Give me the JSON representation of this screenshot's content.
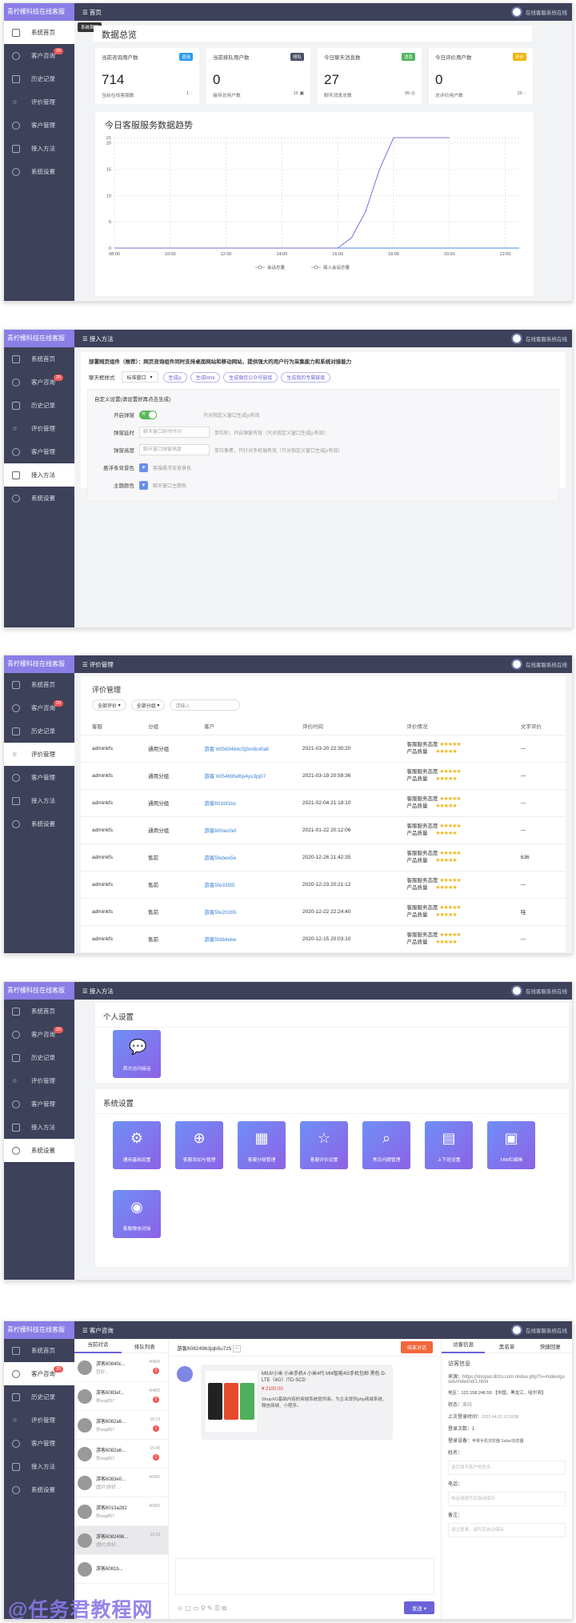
{
  "brand": "青柠檬科技在线客服",
  "user": "在线客服系统在线",
  "nav": {
    "home": "系统首页",
    "consult": "客户咨询",
    "history": "历史记录",
    "review": "评价管理",
    "customer": "客户管理",
    "access": "接入方法",
    "settings": "系统设置",
    "consult_badge": "20"
  },
  "p1": {
    "crumb": "首页",
    "tooltip": "系统首页",
    "overview": "数据总览",
    "stats": [
      {
        "title": "当前咨询用户数",
        "tag": "咨询",
        "tag_color": "#2d9bf0",
        "value": "714",
        "sub": "当前在线客服数",
        "sub_val": "1"
      },
      {
        "title": "当前排队用户数",
        "tag": "排队",
        "tag_color": "#4a4f66",
        "value": "0",
        "sub": "接待总用户数",
        "sub_val": "16"
      },
      {
        "title": "今日聊天消息数",
        "tag": "消息",
        "tag_color": "#4fb55c",
        "value": "27",
        "sub": "聊天消息总数",
        "sub_val": "95"
      },
      {
        "title": "今日评价用户数",
        "tag": "评价",
        "tag_color": "#f2b30c",
        "value": "0",
        "sub": "总评价用户数",
        "sub_val": "25"
      }
    ],
    "trend_title": "今日客服服务数据趋势"
  },
  "chart_data": {
    "type": "line",
    "x": [
      "08:00",
      "10:00",
      "12:00",
      "14:00",
      "16:00",
      "18:00",
      "20:00",
      "22:00"
    ],
    "ylim": [
      0,
      21
    ],
    "yticks": [
      0,
      5,
      10,
      15,
      20,
      21
    ],
    "series": [
      {
        "name": "会话总量",
        "points": [
          [
            8,
            0
          ],
          [
            16,
            0
          ],
          [
            16.5,
            2
          ],
          [
            17,
            7
          ],
          [
            17.5,
            15
          ],
          [
            18,
            21
          ],
          [
            20,
            21
          ]
        ]
      },
      {
        "name": "接入会话总量",
        "points": [
          [
            8,
            0
          ],
          [
            22.5,
            0
          ]
        ]
      }
    ]
  },
  "p2": {
    "crumb": "接入方法",
    "intro": "部署网页组件（推荐）：网页咨询组件同时支持桌面网站和移动网站，提供强大的用户行为采集能力和系统对接能力",
    "style_label": "聊天框样式",
    "style_value": "标准窗口",
    "btns": [
      "生成js",
      "生成html",
      "生成微信公众号链接",
      "生成我的专属链接"
    ],
    "custom_title": "自定义设置(请设置好再点击生成)",
    "rows": [
      {
        "label": "开启弹窗",
        "value": "开",
        "hint": "只对指定义窗口生成js有效"
      },
      {
        "label": "弹窗延时",
        "value": "聊天窗口延时时间",
        "hint": "单位秒，开启弹窗有效（只对指定义窗口生成js有效）"
      },
      {
        "label": "弹窗高度",
        "value": "聊天窗口弹窗高度",
        "hint": "单位像素，只针对手机端有效（只对指定义窗口生成js有效）"
      },
      {
        "label": "悬浮条背景色",
        "value": "客服悬浮条背景色"
      },
      {
        "label": "主题颜色",
        "value": "聊天窗口主题色"
      }
    ]
  },
  "p3": {
    "crumb": "评价管理",
    "title": "评价管理",
    "filters": [
      "全部评价",
      "全部分组"
    ],
    "search_placeholder": "请输入",
    "headers": [
      "客服",
      "分组",
      "客户",
      "评价时间",
      "评价情况",
      "文字评价"
    ],
    "rating_labels": [
      "客服服务态度",
      "产品质量"
    ],
    "stars": "★★★★★",
    "rows": [
      {
        "agent": "adminkfs",
        "group": "通用分组",
        "customer": "游客 60560464c5j5m8c4fa8",
        "time": "2021-03-20 22:30:20",
        "text": "—"
      },
      {
        "agent": "adminkfs",
        "group": "通用分组",
        "customer": "游客 605469faf6p4ys3pj07",
        "time": "2021-03-19 20:59:36",
        "text": "—"
      },
      {
        "agent": "adminkfs",
        "group": "通用分组",
        "customer": "游客601bf1bc",
        "time": "2021-02-04 21:18:10",
        "text": "—"
      },
      {
        "agent": "adminkfs",
        "group": "通用分组",
        "customer": "游客600ac0ef",
        "time": "2021-01-22 20:12:06",
        "text": "—"
      },
      {
        "agent": "adminkfs",
        "group": "售前",
        "customer": "游客5febee5e",
        "time": "2020-12-26 21:42:35",
        "text": "636"
      },
      {
        "agent": "adminkfs",
        "group": "售前",
        "customer": "游客5fe335f5",
        "time": "2020-12-23 20:21:12",
        "text": "—"
      },
      {
        "agent": "adminkfs",
        "group": "售前",
        "customer": "游客5fe20165",
        "time": "2020-12-22 22:24:40",
        "text": "哇"
      },
      {
        "agent": "adminkfs",
        "group": "售前",
        "customer": "游客5fd84ebe",
        "time": "2020-12-15 20:03:10",
        "text": "—"
      }
    ]
  },
  "p4": {
    "crumb": "接入方法",
    "personal": "个人设置",
    "personal_tiles": [
      "首次访问接话"
    ],
    "system": "系统设置",
    "system_tiles": [
      "通用基础设置",
      "客服添加与管理",
      "客服分组管理",
      "客服评价设置",
      "常见问题管理",
      "上下班设置",
      "TAB栏编辑",
      "客服微信对接"
    ]
  },
  "p5": {
    "crumb": "客户咨询",
    "tabs": [
      "当前对话",
      "排队列表"
    ],
    "conversations": [
      {
        "name": "游客60840c...",
        "msg": "您好...",
        "time": "4/4/00",
        "badge": "3"
      },
      {
        "name": "游客6083ef...",
        "msg": "你ssg857",
        "time": "4/4/00",
        "badge": "2"
      },
      {
        "name": "游客6082a6...",
        "msg": "你ssg857",
        "time": "15:13",
        "badge": "1"
      },
      {
        "name": "游客6082a6...",
        "msg": "你ssg857",
        "time": "15:40",
        "badge": "1"
      },
      {
        "name": "游客6083e0...",
        "msg": "[图片]你好 ...",
        "time": "4/3/00",
        "badge": ""
      },
      {
        "name": "游客6013a282",
        "msg": "你ssg857",
        "time": "4/3/00",
        "badge": ""
      },
      {
        "name": "游客6082496...",
        "msg": "[图片]你好 ...",
        "time": "12:19",
        "badge": ""
      },
      {
        "name": "游客6081b...",
        "msg": "",
        "time": "",
        "badge": ""
      }
    ],
    "chat_title": "游客608249b3jqb5u7z5",
    "end_btn": "结束对话",
    "product_desc": "MIUI/小米 小米手机4 小米4代 MI4智能4G手机包邮 黑色 D-LTE（4G）/TD-SCD",
    "product_price": "¥ 2100.00",
    "product_text": "ShopXO基础内容的商城系统提供商。为企业提供php商城系统、微信商城、小程序。",
    "send_btn": "发送",
    "right_tabs": [
      "访客信息",
      "黑名单",
      "快捷回复"
    ],
    "visitor_title": "访客信息",
    "source_label": "来源：",
    "source": "https://shopxo.80zv.com /index.php?s=/index/goods/index/id/1.html",
    "area_label": "地区：",
    "area": "122.158.246.50 【中国，黑龙江，哈尔滨】",
    "status_label": "状态：",
    "status": "离线",
    "last_login_label": "上次登录时间：",
    "last_login": "2021-04-23 12:19:56",
    "login_count_label": "登录次数：",
    "login_count": "1",
    "device_label": "登录设备：",
    "device": "苹果手机浏览器 Safari浏览器",
    "fields": [
      {
        "label": "姓名：",
        "placeholder": "请您填写客户的姓名"
      },
      {
        "label": "电话：",
        "placeholder": "电话请填写后自动保存"
      },
      {
        "label": "备注：",
        "placeholder": "请注意事，请写后自动保存"
      }
    ]
  },
  "watermark": "@任务君教程网"
}
